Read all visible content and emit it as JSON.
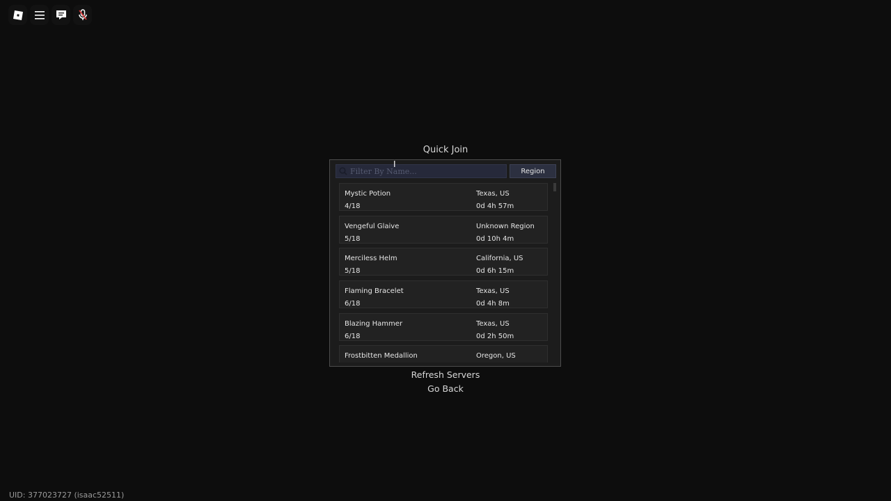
{
  "topbar": {
    "icons": [
      "roblox-logo-icon",
      "menu-icon",
      "chat-icon",
      "microphone-muted-icon"
    ]
  },
  "quick_join": {
    "title": "Quick Join",
    "search": {
      "placeholder": "Filter By Name...",
      "value": ""
    },
    "region_button": "Region",
    "servers": [
      {
        "name": "Mystic Potion",
        "players": "4/18",
        "region": "Texas, US",
        "uptime": "0d 4h 57m"
      },
      {
        "name": "Vengeful Glaive",
        "players": "5/18",
        "region": "Unknown Region",
        "uptime": "0d 10h 4m"
      },
      {
        "name": "Merciless Helm",
        "players": "5/18",
        "region": "California, US",
        "uptime": "0d 6h 15m"
      },
      {
        "name": "Flaming Bracelet",
        "players": "6/18",
        "region": "Texas, US",
        "uptime": "0d 4h 8m"
      },
      {
        "name": "Blazing Hammer",
        "players": "6/18",
        "region": "Texas, US",
        "uptime": "0d 2h 50m"
      },
      {
        "name": "Frostbitten Medallion",
        "players": "",
        "region": "Oregon, US",
        "uptime": ""
      }
    ],
    "refresh_label": "Refresh Servers",
    "back_label": "Go Back"
  },
  "footer": {
    "uid": "UID: 377023727 (isaac52511)"
  }
}
